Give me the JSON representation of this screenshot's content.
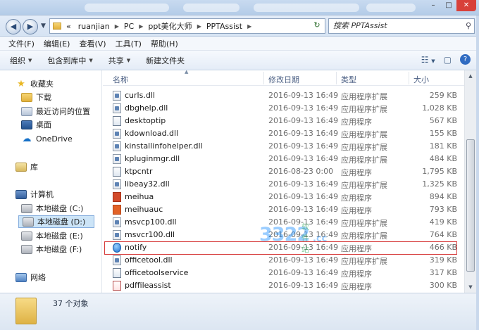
{
  "address": {
    "crumbs": [
      "ruanjian",
      "PC",
      "ppt美化大师",
      "PPTAssist"
    ],
    "overflow": "«"
  },
  "search": {
    "placeholder": "搜索 PPTAssist"
  },
  "menu": [
    "文件(F)",
    "编辑(E)",
    "查看(V)",
    "工具(T)",
    "帮助(H)"
  ],
  "toolbar": {
    "organize": "组织",
    "include_library": "包含到库中",
    "share": "共享",
    "new_folder": "新建文件夹"
  },
  "nav": {
    "favorites": "收藏夹",
    "downloads": "下载",
    "recent": "最近访问的位置",
    "desktop": "桌面",
    "onedrive": "OneDrive",
    "libraries": "库",
    "computer": "计算机",
    "disk_c": "本地磁盘 (C:)",
    "disk_d": "本地磁盘 (D:)",
    "disk_e": "本地磁盘 (E:)",
    "disk_f": "本地磁盘 (F:)",
    "network": "网络"
  },
  "columns": {
    "name": "名称",
    "date": "修改日期",
    "type": "类型",
    "size": "大小"
  },
  "files": [
    {
      "name": "curls.dll",
      "date": "2016-09-13 16:49",
      "type": "应用程序扩展",
      "size": "259 KB",
      "icon": "dll"
    },
    {
      "name": "dbghelp.dll",
      "date": "2016-09-13 16:49",
      "type": "应用程序扩展",
      "size": "1,028 KB",
      "icon": "dll"
    },
    {
      "name": "desktoptip",
      "date": "2016-09-13 16:49",
      "type": "应用程序",
      "size": "567 KB",
      "icon": "exe-plain"
    },
    {
      "name": "kdownload.dll",
      "date": "2016-09-13 16:49",
      "type": "应用程序扩展",
      "size": "155 KB",
      "icon": "dll"
    },
    {
      "name": "kinstallinfohelper.dll",
      "date": "2016-09-13 16:49",
      "type": "应用程序扩展",
      "size": "181 KB",
      "icon": "dll"
    },
    {
      "name": "kpluginmgr.dll",
      "date": "2016-09-13 16:49",
      "type": "应用程序扩展",
      "size": "484 KB",
      "icon": "dll"
    },
    {
      "name": "ktpcntr",
      "date": "2016-08-23 0:00",
      "type": "应用程序",
      "size": "1,795 KB",
      "icon": "exe-plain"
    },
    {
      "name": "libeay32.dll",
      "date": "2016-09-13 16:49",
      "type": "应用程序扩展",
      "size": "1,325 KB",
      "icon": "dll"
    },
    {
      "name": "meihua",
      "date": "2016-09-13 16:49",
      "type": "应用程序",
      "size": "894 KB",
      "icon": "exe-red"
    },
    {
      "name": "meihuauc",
      "date": "2016-09-13 16:49",
      "type": "应用程序",
      "size": "793 KB",
      "icon": "exe-orange"
    },
    {
      "name": "msvcp100.dll",
      "date": "2016-09-13 16:49",
      "type": "应用程序扩展",
      "size": "419 KB",
      "icon": "dll"
    },
    {
      "name": "msvcr100.dll",
      "date": "2016-09-13 16:49",
      "type": "应用程序扩展",
      "size": "764 KB",
      "icon": "dll"
    },
    {
      "name": "notify",
      "date": "2016-09-13 16:49",
      "type": "应用程序",
      "size": "466 KB",
      "icon": "exe-blue"
    },
    {
      "name": "officetool.dll",
      "date": "2016-09-13 16:49",
      "type": "应用程序扩展",
      "size": "319 KB",
      "icon": "dll"
    },
    {
      "name": "officetoolservice",
      "date": "2016-09-13 16:49",
      "type": "应用程序",
      "size": "317 KB",
      "icon": "exe-plain"
    },
    {
      "name": "pdffileassist",
      "date": "2016-09-13 16:49",
      "type": "应用程序",
      "size": "300 KB",
      "icon": "exe-pdf"
    }
  ],
  "status": {
    "count": "37 个对象"
  },
  "watermark": {
    "main": "3322",
    "sub": "软件站",
    "domain": ".cc"
  }
}
